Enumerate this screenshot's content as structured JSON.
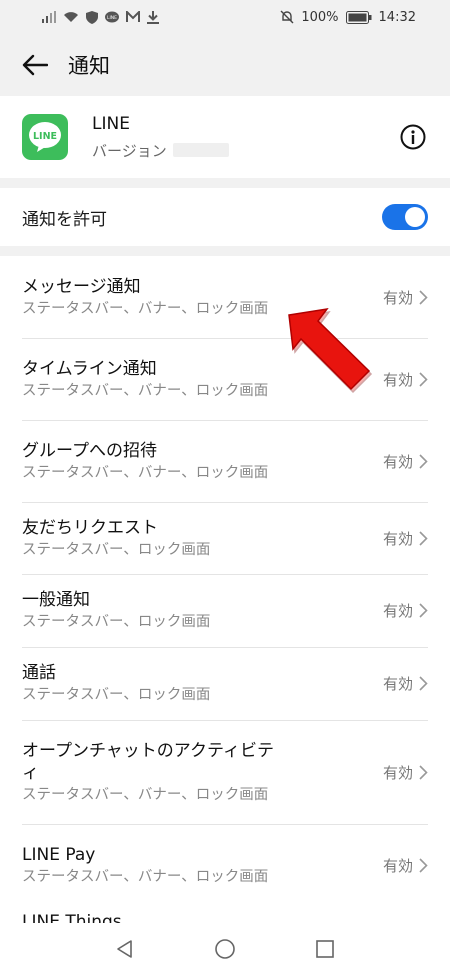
{
  "status_bar": {
    "battery": "100%",
    "time": "14:32"
  },
  "app_bar": {
    "title": "通知"
  },
  "app_info": {
    "name": "LINE",
    "version_label": "バージョン",
    "icon_label": "LINE"
  },
  "allow": {
    "label": "通知を許可",
    "enabled": true
  },
  "items": [
    {
      "title": "メッセージ通知",
      "subtitle": "ステータスバー、バナー、ロック画面",
      "status": "有効"
    },
    {
      "title": "タイムライン通知",
      "subtitle": "ステータスバー、バナー、ロック画面",
      "status": "有効"
    },
    {
      "title": "グループへの招待",
      "subtitle": "ステータスバー、バナー、ロック画面",
      "status": "有効"
    },
    {
      "title": "友だちリクエスト",
      "subtitle": "ステータスバー、ロック画面",
      "status": "有効"
    },
    {
      "title": "一般通知",
      "subtitle": "ステータスバー、ロック画面",
      "status": "有効"
    },
    {
      "title": "通話",
      "subtitle": "ステータスバー、ロック画面",
      "status": "有効"
    },
    {
      "title": "オープンチャットのアクティビティ",
      "subtitle": "ステータスバー、バナー、ロック画面",
      "status": "有効"
    },
    {
      "title": "LINE Pay",
      "subtitle": "ステータスバー、バナー、ロック画面",
      "status": "有効"
    },
    {
      "title": "LINE Things",
      "subtitle": "",
      "status": ""
    }
  ],
  "colors": {
    "toggle_on": "#1a73e8",
    "line_green": "#3dbd5b",
    "annotation_arrow": "#e8140e"
  }
}
